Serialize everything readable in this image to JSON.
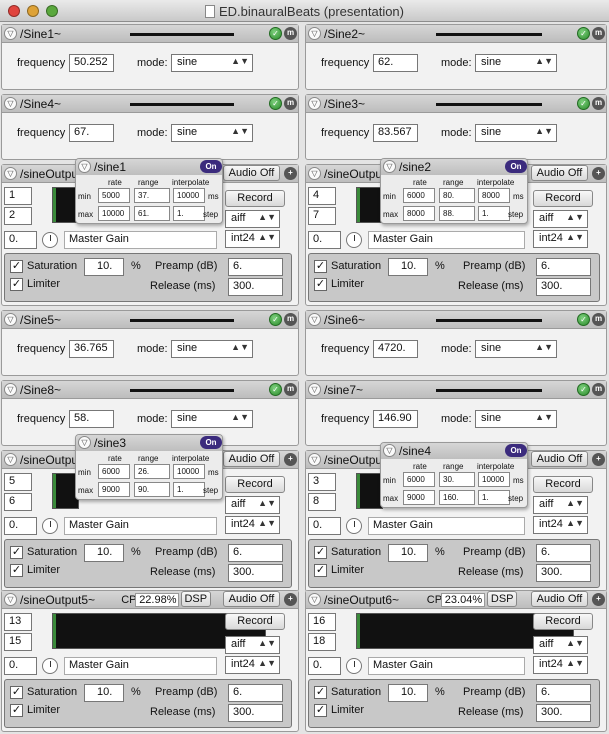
{
  "window": {
    "title": "ED.binauralBeats (presentation)"
  },
  "common": {
    "freq_label": "frequency",
    "mode_label": "mode:",
    "mode_value": "sine",
    "audio_off": "Audio Off",
    "record": "Record",
    "fmt1": "aiff",
    "fmt2": "int24",
    "master_gain": "Master Gain",
    "saturation": "Saturation",
    "limiter": "Limiter",
    "pct": "%",
    "preamp": "Preamp (dB)",
    "release": "Release (ms)",
    "rate": "rate",
    "range": "range",
    "interpolate": "interpolate",
    "min": "min",
    "max": "max",
    "ms": "ms",
    "step": "step",
    "on": "On",
    "dsp": "DSP",
    "cpu": "CPU:",
    "check": "✓",
    "m": "m",
    "chk_circle": "✓",
    "triangle": "▽",
    "plus": "+",
    "updown": "▲▼",
    "sat_value": "10.",
    "preamp_value": "6.",
    "release_value": "300.",
    "gain_value": "0."
  },
  "sines": {
    "s1": {
      "name": "/Sine1~",
      "freq": "50.252"
    },
    "s2": {
      "name": "/Sine2~",
      "freq": "62."
    },
    "s4": {
      "name": "/Sine4~",
      "freq": "67."
    },
    "s3": {
      "name": "/Sine3~",
      "freq": "83.567"
    },
    "s5": {
      "name": "/Sine5~",
      "freq": "36.765"
    },
    "s6": {
      "name": "/Sine6~",
      "freq": "4720."
    },
    "s8": {
      "name": "/Sine8~",
      "freq": "58."
    },
    "s7": {
      "name": "/sine7~",
      "freq": "146.90"
    }
  },
  "outputs": {
    "o1": {
      "name": "/sineOutput",
      "ch1": "1",
      "ch2": "2"
    },
    "o2": {
      "name": "/sineOutpu",
      "ch1": "4",
      "ch2": "7"
    },
    "o3": {
      "name": "/sineOutput",
      "ch1": "5",
      "ch2": "6"
    },
    "o4": {
      "name": "/sineOutpu",
      "ch1": "3",
      "ch2": "8"
    },
    "o5": {
      "name": "/sineOutput5~",
      "ch1": "13",
      "ch2": "15",
      "cpu": "22.98%"
    },
    "o6": {
      "name": "/sineOutput6~",
      "ch1": "16",
      "ch2": "18",
      "cpu": "23.04%"
    }
  },
  "popups": {
    "p1": {
      "name": "/sine1",
      "rmin": "5000",
      "gmin": "37.",
      "imin": "10000",
      "rmax": "10000",
      "gmax": "61.",
      "imax": "1."
    },
    "p2": {
      "name": "/sine2",
      "rmin": "6000",
      "gmin": "80.",
      "imin": "8000",
      "rmax": "8000",
      "gmax": "88.",
      "imax": "1."
    },
    "p3": {
      "name": "/sine3",
      "rmin": "6000",
      "gmin": "26.",
      "imin": "10000",
      "rmax": "9000",
      "gmax": "90.",
      "imax": "1."
    },
    "p4": {
      "name": "/sine4",
      "rmin": "6000",
      "gmin": "30.",
      "imin": "10000",
      "rmax": "9000",
      "gmax": "160.",
      "imax": "1."
    }
  }
}
